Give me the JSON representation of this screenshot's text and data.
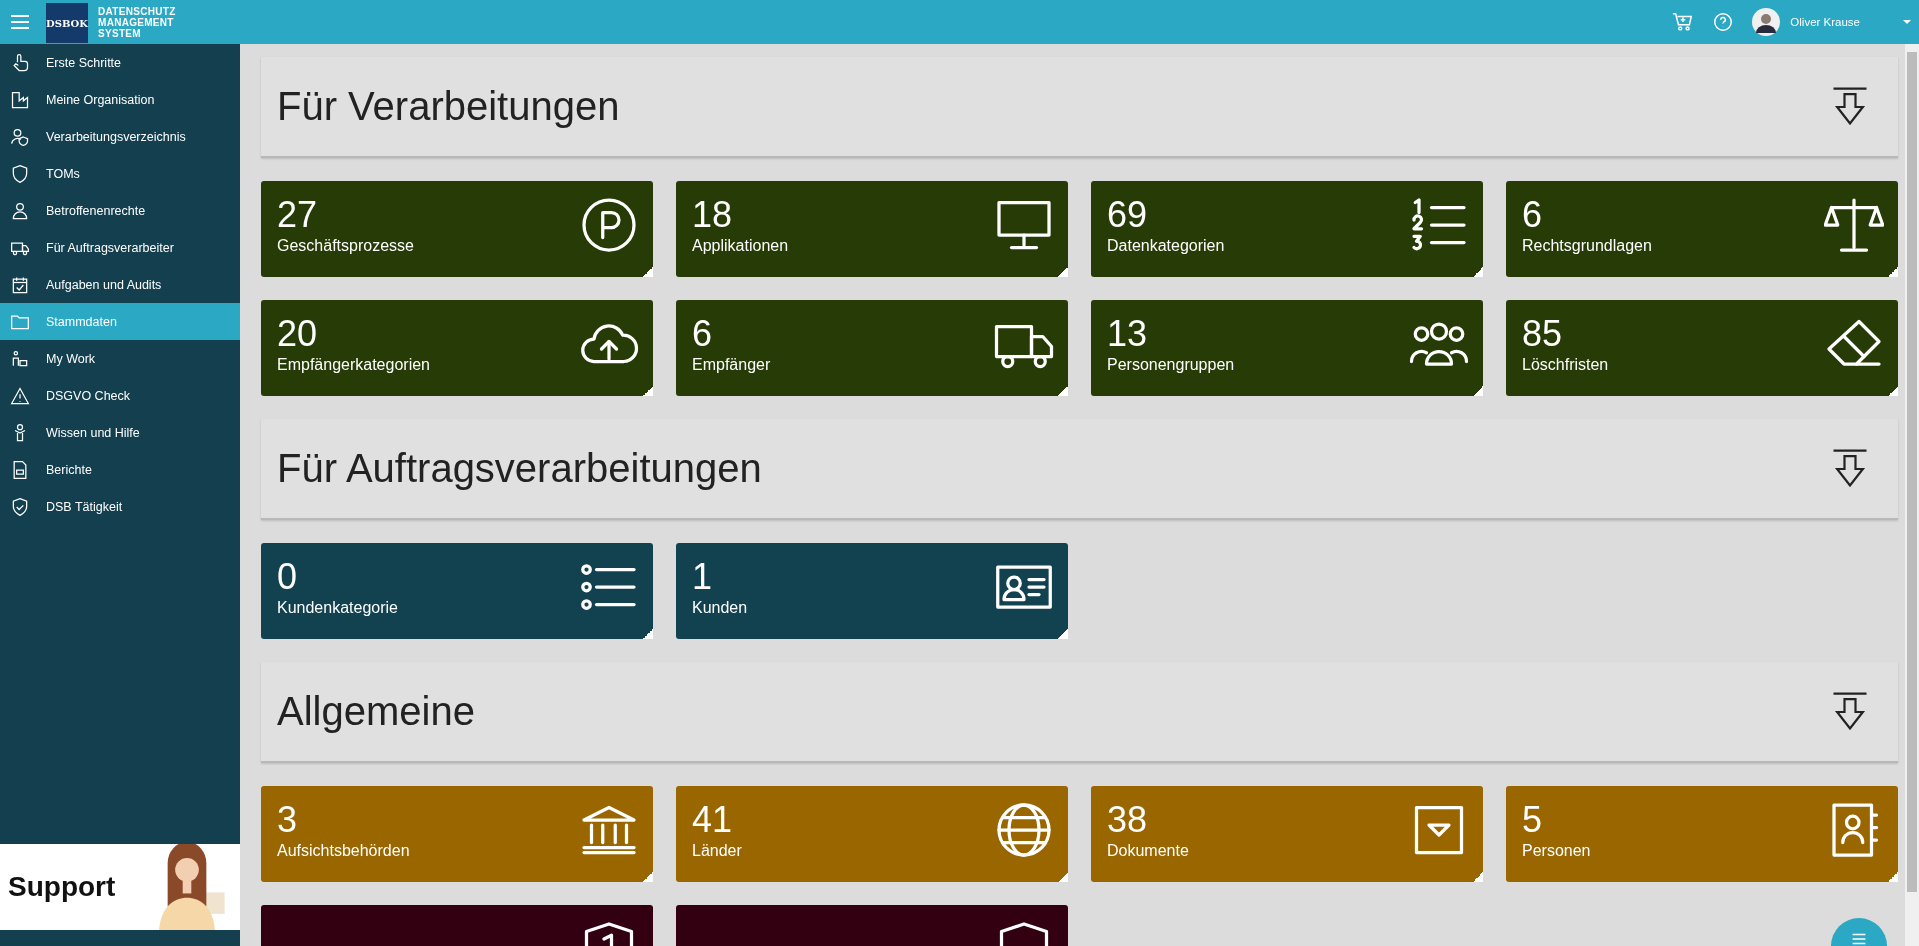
{
  "header": {
    "logo": "DSBOK",
    "brand": [
      "DATENSCHUTZ",
      "MANAGEMENT",
      "SYSTEM"
    ],
    "user": "Oliver Krause"
  },
  "sidebar": {
    "items": [
      {
        "label": "Erste Schritte",
        "kind": "hand",
        "selected": false
      },
      {
        "label": "Meine Organisation",
        "kind": "factory",
        "selected": false
      },
      {
        "label": "Verarbeitungsverzeichnis",
        "kind": "user-shield",
        "selected": false
      },
      {
        "label": "TOMs",
        "kind": "shield",
        "selected": false
      },
      {
        "label": "Betroffenenrechte",
        "kind": "user",
        "selected": false
      },
      {
        "label": "Für Auftragsverarbeiter",
        "kind": "truck",
        "selected": false
      },
      {
        "label": "Aufgaben und Audits",
        "kind": "calendar-check",
        "selected": false
      },
      {
        "label": "Stammdaten",
        "kind": "folder",
        "selected": true
      },
      {
        "label": "My Work",
        "kind": "workers",
        "selected": false
      },
      {
        "label": "DSGVO Check",
        "kind": "warning",
        "selected": false
      },
      {
        "label": "Wissen und Hilfe",
        "kind": "person",
        "selected": false
      },
      {
        "label": "Berichte",
        "kind": "document",
        "selected": false
      },
      {
        "label": "DSB Tätigkeit",
        "kind": "shield-check",
        "selected": false
      }
    ],
    "banner": {
      "text": "Support",
      "kind": "picture"
    }
  },
  "sections": [
    {
      "title": "Für Verarbeitungen",
      "tiles": [
        {
          "count": "27",
          "label": "Geschäftsprozesse",
          "kind": "p-circle",
          "color": "#263b05"
        },
        {
          "count": "18",
          "label": "Applikationen",
          "kind": "monitor",
          "color": "#263b05"
        },
        {
          "count": "69",
          "label": "Datenkategorien",
          "kind": "numbered-list",
          "color": "#263b05"
        },
        {
          "count": "6",
          "label": "Rechtsgrundlagen",
          "kind": "scales",
          "color": "#263b05"
        },
        {
          "count": "20",
          "label": "Empfängerkategorien",
          "kind": "cloud-upload",
          "color": "#263b05"
        },
        {
          "count": "6",
          "label": "Empfänger",
          "kind": "truck",
          "color": "#263b05"
        },
        {
          "count": "13",
          "label": "Personengruppen",
          "kind": "people",
          "color": "#263b05"
        },
        {
          "count": "85",
          "label": "Löschfristen",
          "kind": "eraser",
          "color": "#263b05"
        }
      ]
    },
    {
      "title": "Für Auftragsverarbeitungen",
      "tiles": [
        {
          "count": "0",
          "label": "Kundenkategorie",
          "kind": "list",
          "color": "#12414f"
        },
        {
          "count": "1",
          "label": "Kunden",
          "kind": "id-card",
          "color": "#12414f"
        }
      ]
    },
    {
      "title": "Allgemeine",
      "tiles": [
        {
          "count": "3",
          "label": "Aufsichtsbehörden",
          "kind": "bank",
          "color": "#996600"
        },
        {
          "count": "41",
          "label": "Länder",
          "kind": "globe",
          "color": "#996600"
        },
        {
          "count": "38",
          "label": "Dokumente",
          "kind": "dropdown",
          "color": "#996600"
        },
        {
          "count": "5",
          "label": "Personen",
          "kind": "contact-book",
          "color": "#996600"
        },
        {
          "kind": "shield-1",
          "color": "#320010"
        },
        {
          "kind": "shield",
          "color": "#320010"
        }
      ]
    }
  ]
}
